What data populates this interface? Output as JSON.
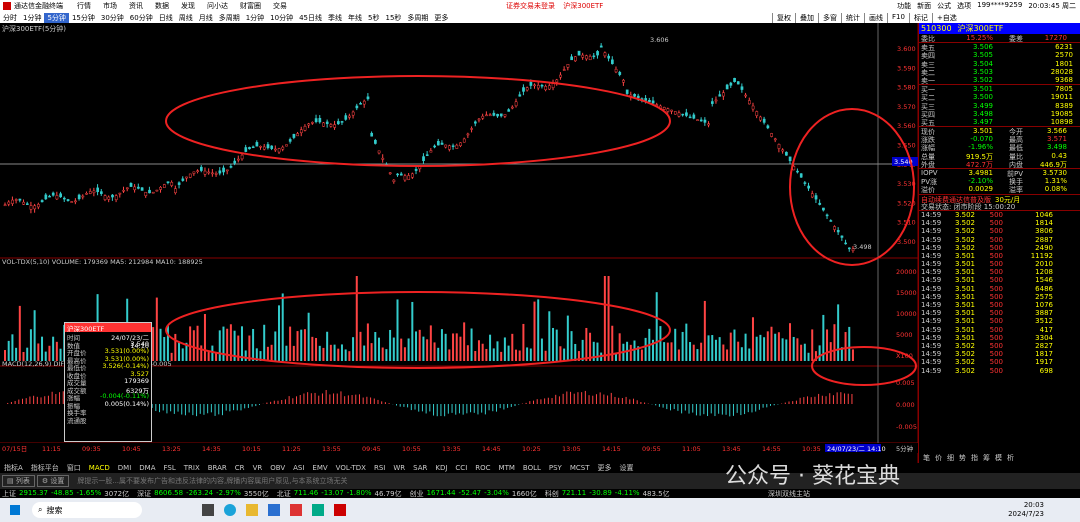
{
  "app_title": "通达信金融终端",
  "menu": [
    "行情",
    "市场",
    "资讯",
    "数据",
    "发现",
    "问小达",
    "财富圈",
    "交易"
  ],
  "notice": "证券交易未登录",
  "notice2": "沪深300ETF",
  "title_right": [
    "功能",
    "新面",
    "公式",
    "选项"
  ],
  "user": "199****9259",
  "clock": "20:03:45 周二",
  "periods": [
    "分时",
    "1分钟",
    "5分钟",
    "15分钟",
    "30分钟",
    "60分钟",
    "日线",
    "周线",
    "月线",
    "多周期",
    "1分钟",
    "10分钟",
    "45日线",
    "季线",
    "年线",
    "5秒",
    "15秒",
    "多周期",
    "更多"
  ],
  "active_period": "5分钟",
  "toolbar_right": [
    "复权",
    "叠加",
    "多窗",
    "统计",
    "画线",
    "F10",
    "标记",
    "+自选"
  ],
  "chart_title": "沪深300ETF(5分钟)",
  "price_axis": [
    "3.600",
    "3.590",
    "3.580",
    "3.570",
    "3.560",
    "3.550",
    "3.540",
    "3.530",
    "3.520",
    "3.510",
    "3.500"
  ],
  "high_label": "3.606",
  "low_label": "3.498",
  "current_price_tag": "3.540",
  "vol_header": "VOL-TDX(5,10) VOLUME: 179369 MA5: 212984 MA10: 188925",
  "vol_axis": [
    "20000",
    "15000",
    "10000",
    "5000",
    "X100"
  ],
  "macd_header": "MACD(12,26,9) DIF: 0.001 DEA: 0.003 MACD: -0.005",
  "macd_axis": [
    "0.005",
    "0.000",
    "-0.005"
  ],
  "time_axis": [
    "07/15日",
    "11:15",
    "09:35",
    "10:45",
    "13:25",
    "14:35",
    "10:15",
    "11:25",
    "13:55",
    "09:45",
    "10:55",
    "13:35",
    "14:45",
    "10:25",
    "13:05",
    "14:15",
    "09:55",
    "11:05",
    "13:45",
    "14:55",
    "10:35",
    "13:15"
  ],
  "time_axis_hl": "24/07/23/二 14:10",
  "period_badge": "5分钟",
  "indicator_tabs": [
    "指标A",
    "指标平台",
    "窗口",
    "MACD",
    "DMI",
    "DMA",
    "FSL",
    "TRIX",
    "BRAR",
    "CR",
    "VR",
    "OBV",
    "ASI",
    "EMV",
    "VOL-TDX",
    "RSI",
    "WR",
    "SAR",
    "KDJ",
    "CCI",
    "ROC",
    "MTM",
    "BOLL",
    "PSY",
    "MCST",
    "更多",
    "设置"
  ],
  "tooltip": {
    "title": "沪深300ETF",
    "rows": [
      [
        "时间",
        "24/07/23/二 14:10"
      ],
      [
        "数值",
        "3.540"
      ],
      [
        "开盘价",
        "3.531(0.00%)"
      ],
      [
        "最高价",
        "3.531(0.00%)"
      ],
      [
        "最低价",
        "3.526(-0.14%)"
      ],
      [
        "收盘价",
        "3.527"
      ],
      [
        "成交量",
        "179369"
      ],
      [
        "成交额",
        "6329万"
      ],
      [
        "涨幅",
        "-0.004(-0.11%)"
      ],
      [
        "振幅",
        "0.005(0.14%)"
      ],
      [
        "换手率",
        ""
      ],
      [
        "流通股",
        ""
      ]
    ]
  },
  "quote": {
    "code": "510300",
    "name": "沪深300ETF",
    "weibi_label": "委比",
    "weibi": "15.25%",
    "weicha_label": "委差",
    "weicha": "17270",
    "asks": [
      [
        "卖五",
        "3.506",
        "6231"
      ],
      [
        "卖四",
        "3.505",
        "2570"
      ],
      [
        "卖三",
        "3.504",
        "1801"
      ],
      [
        "卖二",
        "3.503",
        "28028"
      ],
      [
        "卖一",
        "3.502",
        "9368"
      ]
    ],
    "bids": [
      [
        "买一",
        "3.501",
        "7805"
      ],
      [
        "买二",
        "3.500",
        "19011"
      ],
      [
        "买三",
        "3.499",
        "8389"
      ],
      [
        "买四",
        "3.498",
        "19085"
      ],
      [
        "买五",
        "3.497",
        "10898"
      ]
    ],
    "stats": [
      [
        "现价",
        "3.501",
        "今开",
        "3.566"
      ],
      [
        "涨跌",
        "-0.070",
        "最高",
        "3.571"
      ],
      [
        "涨幅",
        "-1.96%",
        "最低",
        "3.498"
      ],
      [
        "总量",
        "919.5万",
        "量比",
        "0.43"
      ],
      [
        "外盘",
        "472.7万",
        "内盘",
        "446.9万"
      ]
    ],
    "iopv": [
      [
        "IOPV",
        "3.4981",
        "前PV",
        "3.5730"
      ],
      [
        "PV涨",
        "-2.10%",
        "换手",
        "1.31%"
      ],
      [
        "溢价",
        "0.0029",
        "溢率",
        "0.08%"
      ]
    ],
    "ad": "自动续费通达信普及版",
    "ad_price": "30元/月",
    "trade_state": "交易状态: 闭市阶段 15:00:20",
    "ticks": [
      [
        "14:59",
        "3.502",
        "500",
        "1046"
      ],
      [
        "14:59",
        "3.502",
        "500",
        "1814"
      ],
      [
        "14:59",
        "3.502",
        "500",
        "3806"
      ],
      [
        "14:59",
        "3.502",
        "500",
        "2887"
      ],
      [
        "14:59",
        "3.502",
        "500",
        "2490"
      ],
      [
        "14:59",
        "3.501",
        "500",
        "11192"
      ],
      [
        "14:59",
        "3.501",
        "500",
        "2010"
      ],
      [
        "14:59",
        "3.501",
        "500",
        "1208"
      ],
      [
        "14:59",
        "3.501",
        "500",
        "1546"
      ],
      [
        "14:59",
        "3.501",
        "500",
        "6486"
      ],
      [
        "14:59",
        "3.501",
        "500",
        "2575"
      ],
      [
        "14:59",
        "3.501",
        "500",
        "1076"
      ],
      [
        "14:59",
        "3.501",
        "500",
        "3887"
      ],
      [
        "14:59",
        "3.501",
        "500",
        "3512"
      ],
      [
        "14:59",
        "3.501",
        "500",
        "417"
      ],
      [
        "14:59",
        "3.501",
        "500",
        "3304"
      ],
      [
        "14:59",
        "3.502",
        "500",
        "2827"
      ],
      [
        "14:59",
        "3.502",
        "500",
        "1817"
      ],
      [
        "14:59",
        "3.502",
        "500",
        "1917"
      ],
      [
        "14:59",
        "3.502",
        "500",
        "698"
      ]
    ],
    "panel_tabs": [
      "笔",
      "价",
      "细",
      "势",
      "指",
      "筹",
      "模",
      "析"
    ]
  },
  "bottom_tabs": [
    "列表",
    "设置"
  ],
  "bottom_right_tabs": [
    "扩展A",
    "关联报价",
    "财富圈",
    "产品概要",
    "基金持仓"
  ],
  "info_text": "牌提示一股...属不要发布广告和违反法律的内容,牌播内容属用户原见,与本系统立场无关",
  "status": [
    [
      "上证",
      "2915.37",
      "-48.85",
      "-1.65%",
      "3072亿"
    ],
    [
      "深证",
      "8606.58",
      "-263.24",
      "-2.97%",
      "3550亿"
    ],
    [
      "北证",
      "711.46",
      "-13.07",
      "-1.80%",
      "46.79亿"
    ],
    [
      "创业",
      "1671.44",
      "-52.47",
      "-3.04%",
      "1660亿"
    ],
    [
      "科创",
      "721.11",
      "-30.89",
      "-4.11%",
      "483.5亿"
    ]
  ],
  "status_right": "深圳双线主站",
  "watermark": "公众号 · 葵花宝典",
  "taskbar": {
    "search": "搜索",
    "time": "20:03",
    "date": "2024/7/23"
  }
}
